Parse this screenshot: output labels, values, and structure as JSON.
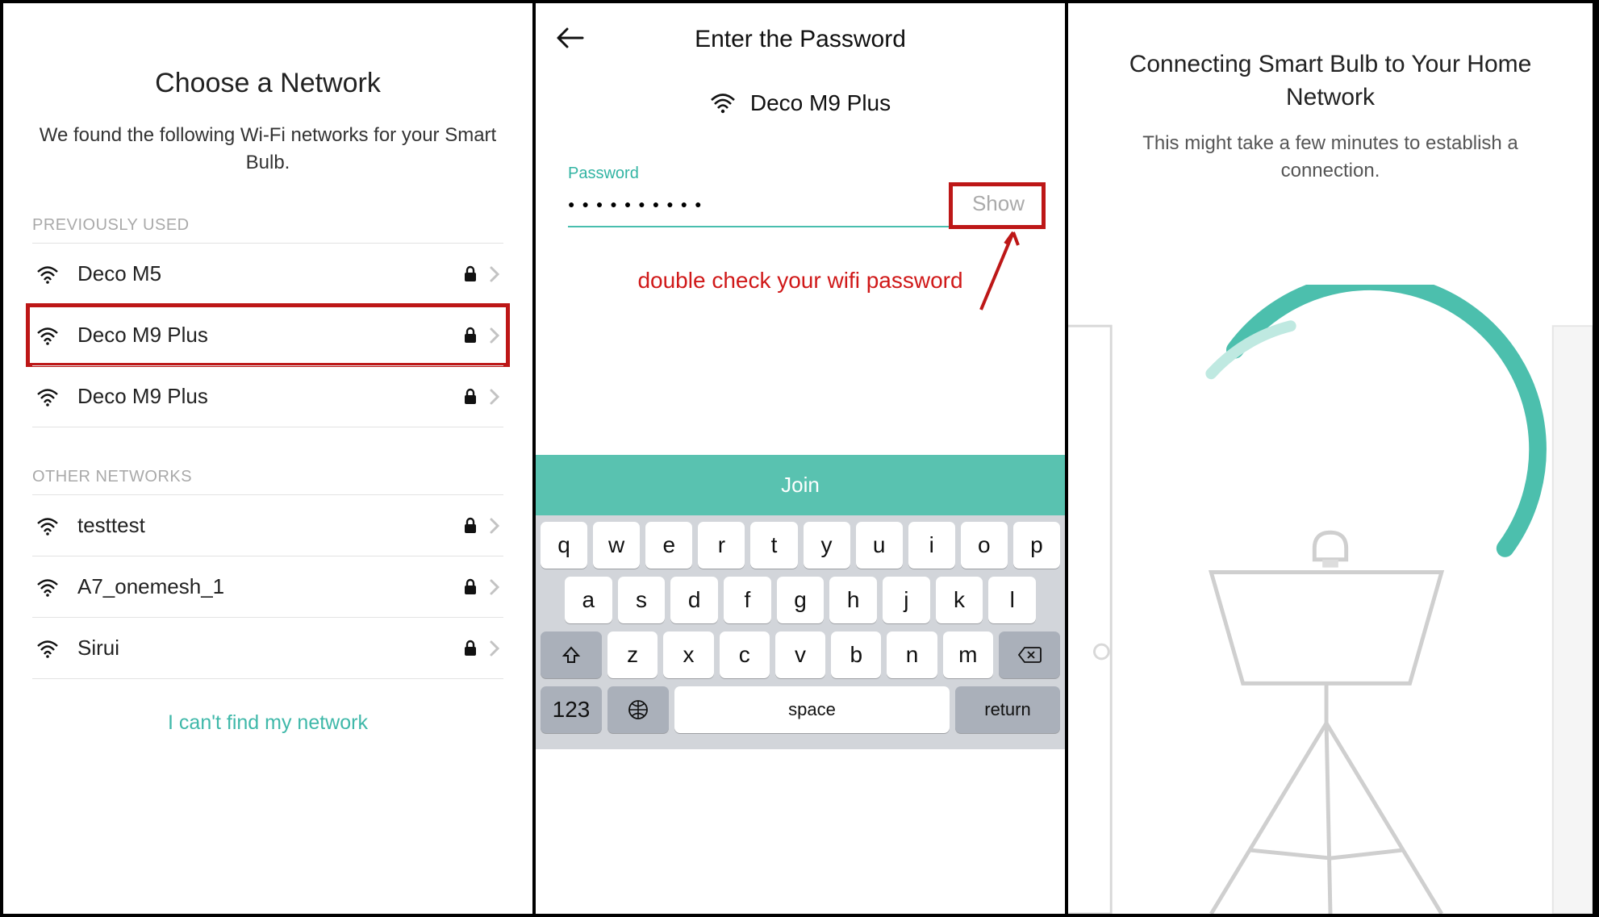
{
  "panel1": {
    "title": "Choose a Network",
    "subtitle": "We found the following Wi-Fi networks for your Smart Bulb.",
    "section_prev": "PREVIOUSLY USED",
    "section_other": "OTHER NETWORKS",
    "prev_networks": [
      {
        "name": "Deco M5",
        "locked": true,
        "highlight": false
      },
      {
        "name": "Deco M9 Plus",
        "locked": true,
        "highlight": true
      },
      {
        "name": "Deco M9 Plus",
        "locked": true,
        "highlight": false
      }
    ],
    "other_networks": [
      {
        "name": "testtest",
        "locked": true
      },
      {
        "name": "A7_onemesh_1",
        "locked": true
      },
      {
        "name": "Sirui",
        "locked": true
      }
    ],
    "footer_link": "I can't find my network"
  },
  "panel2": {
    "header": "Enter the Password",
    "ssid": "Deco M9 Plus",
    "password_label": "Password",
    "password_mask": "●●●●●●●●●●",
    "show_label": "Show",
    "annotation": "double check your wifi password",
    "join_label": "Join",
    "keyboard": {
      "row1": [
        "q",
        "w",
        "e",
        "r",
        "t",
        "y",
        "u",
        "i",
        "o",
        "p"
      ],
      "row2": [
        "a",
        "s",
        "d",
        "f",
        "g",
        "h",
        "j",
        "k",
        "l"
      ],
      "row3": [
        "z",
        "x",
        "c",
        "v",
        "b",
        "n",
        "m"
      ],
      "numkey": "123",
      "space": "space",
      "return": "return"
    }
  },
  "panel3": {
    "title": "Connecting Smart Bulb to Your Home Network",
    "subtitle": "This might take a few minutes to establish a connection."
  },
  "colors": {
    "accent": "#3fb8a9",
    "highlight": "#bd1717"
  }
}
